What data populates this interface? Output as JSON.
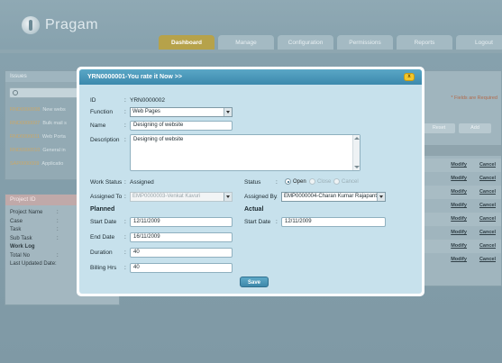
{
  "app": {
    "name": "Pragam",
    "nav_tabs": [
      "Dashboard",
      "Manage",
      "Configuration",
      "Permissions",
      "Reports",
      "Logout"
    ],
    "active_tab": "Dashboard"
  },
  "issues_panel": {
    "title": "Issues",
    "rows": [
      {
        "id": "RND0000008",
        "desc": "New webs"
      },
      {
        "id": "RND0000007",
        "desc": "Bulk mail s"
      },
      {
        "id": "RND0000011",
        "desc": "Web Porta"
      },
      {
        "id": "RND0000010",
        "desc": "General in"
      },
      {
        "id": "SAP0000009",
        "desc": "Applicatio"
      }
    ]
  },
  "project_panel": {
    "title": "Project ID",
    "fields": [
      {
        "label": "Project Name",
        "value": ":"
      },
      {
        "label": "Case",
        "value": ":"
      },
      {
        "label": "Task",
        "value": ":"
      },
      {
        "label": "Sub Task",
        "value": ":"
      },
      {
        "label": "Work Log",
        "value": ""
      },
      {
        "label": "Total No",
        "value": ":"
      },
      {
        "label": "Last Updated Date:",
        "value": ""
      }
    ]
  },
  "right_panel": {
    "required_note": "* Fields are Required",
    "buttons": [
      "Reset",
      "Add"
    ],
    "row_actions": {
      "modify": "Modify",
      "cancel": "Cancel"
    },
    "row_count": 8
  },
  "modal": {
    "title": "YRN0000001-You rate it Now >>",
    "close_label": "x",
    "id_label": "ID",
    "id_value": "YRN0000002",
    "function_label": "Function",
    "function_value": "Web Pages",
    "name_label": "Name",
    "name_value": "Designing of website",
    "description_label": "Description",
    "description_value": "Designing of website",
    "work_status_label": "Work Status",
    "work_status_value": "Assigned",
    "status_label": "Status",
    "status_options": [
      "Open",
      "Close",
      "Cancel"
    ],
    "status_selected": "Open",
    "assigned_to_label": "Assigned To",
    "assigned_to_value": "EMP0000003-Venkat Kavuri",
    "assigned_by_label": "Assigned By",
    "assigned_by_value": "EMP0000004-Charan Kumar Rajapanti",
    "planned_label": "Planned",
    "actual_label": "Actual",
    "start_date_label": "Start Date",
    "planned_start_date": "12/11/2009",
    "actual_start_date": "12/11/2009",
    "end_date_label": "End Date",
    "end_date_value": "16/11/2009",
    "duration_label": "Duration",
    "duration_value": "40",
    "billing_hrs_label": "Billing Hrs",
    "billing_hrs_value": "40",
    "save_label": "Save"
  }
}
